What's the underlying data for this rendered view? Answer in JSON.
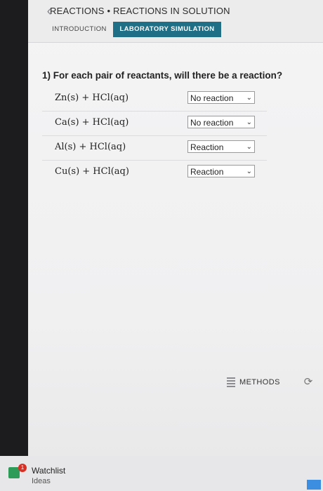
{
  "header": {
    "section_title": "REACTIONS • REACTIONS IN SOLUTION",
    "tabs": [
      {
        "label": "INTRODUCTION"
      },
      {
        "label": "LABORATORY SIMULATION"
      }
    ]
  },
  "question": {
    "prompt": "1) For each pair of reactants, will there be a reaction?",
    "rows": [
      {
        "equation": "Zn(s) + HCl(aq)",
        "answer": "No reaction"
      },
      {
        "equation": "Ca(s) + HCl(aq)",
        "answer": "No reaction"
      },
      {
        "equation": "Al(s) + HCl(aq)",
        "answer": "Reaction"
      },
      {
        "equation": "Cu(s) + HCl(aq)",
        "answer": "Reaction"
      }
    ]
  },
  "footer": {
    "methods_label": "METHODS"
  },
  "taskbar": {
    "watchlist_badge": "1",
    "watchlist_title": "Watchlist",
    "watchlist_sub": "Ideas"
  },
  "colors": {
    "accent_tab": "#1f6f86",
    "watchlist_green": "#2f9b59",
    "badge_red": "#d93025"
  }
}
